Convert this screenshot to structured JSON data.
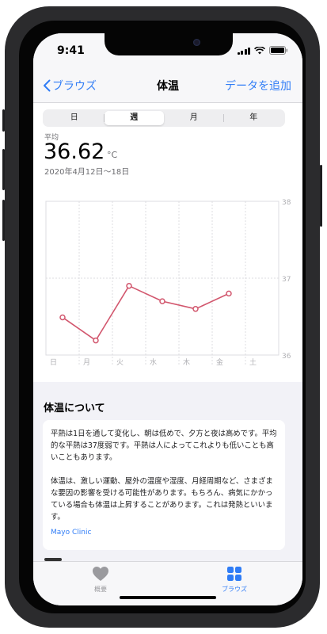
{
  "status": {
    "time": "9:41"
  },
  "nav": {
    "back_label": "ブラウズ",
    "title": "体温",
    "add_label": "データを追加"
  },
  "segments": [
    "日",
    "週",
    "月",
    "年"
  ],
  "summary": {
    "label": "平均",
    "value": "36.62",
    "unit": "°C",
    "date_range": "2020年4月12日～18日"
  },
  "chart_data": {
    "type": "line",
    "categories": [
      "日",
      "月",
      "火",
      "水",
      "木",
      "金",
      "土"
    ],
    "values": [
      36.49,
      36.19,
      36.9,
      36.7,
      36.6,
      36.8,
      null
    ],
    "y_ticks": [
      "38",
      "37",
      "36"
    ],
    "ylim": [
      36,
      38
    ],
    "color": "#d2576e",
    "grid": true
  },
  "about": {
    "title": "体温について",
    "paragraph1": "平熱は1日を通して変化し、朝は低めで、夕方と夜は高めです。平均的な平熱は37度弱です。平熱は人によってこれよりも低いことも高いこともあります。",
    "paragraph2": "体温は、激しい運動、屋外の温度や湿度、月経周期など、さまざまな要因の影響を受ける可能性があります。もちろん、病気にかかっている場合も体温は上昇することがあります。これは発熱といいます。",
    "source": "Mayo Clinic"
  },
  "tabs": [
    {
      "label": "概要",
      "icon": "heart-icon",
      "color": "#9a9a9e"
    },
    {
      "label": "ブラウズ",
      "icon": "grid-icon",
      "color": "#2f7cf6"
    }
  ]
}
